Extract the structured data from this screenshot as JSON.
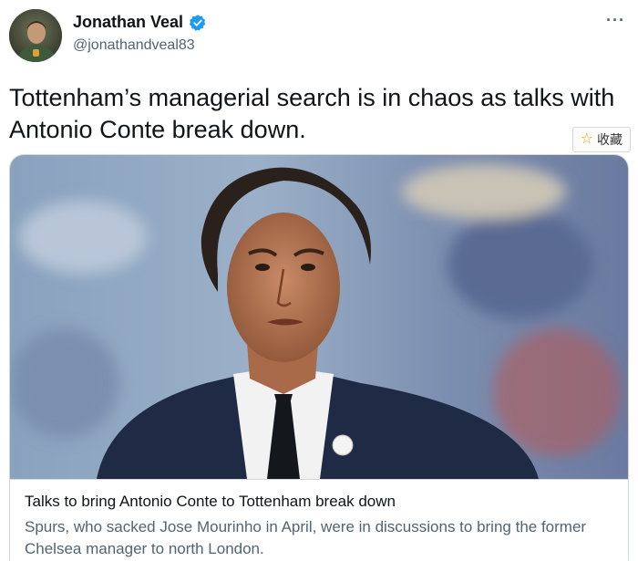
{
  "author": {
    "display_name": "Jonathan Veal",
    "handle": "@jonathandveal83",
    "verified": true,
    "avatar": "user-avatar"
  },
  "more_icon": "more-horizontal-icon",
  "more_label": "···",
  "tweet": {
    "text": "Tottenham’s managerial search is in chaos as talks with Antonio Conte break down."
  },
  "favorite": {
    "icon": "star-icon",
    "label": "收藏"
  },
  "card": {
    "image": "antonio-conte-photo",
    "title": "Talks to bring Antonio Conte to Tottenham break down",
    "description": "Spurs, who sacked Jose Mourinho in April, were in discussions to bring the former Chelsea manager to north London."
  },
  "colors": {
    "verified_badge": "#1d9bf0",
    "secondary_text": "#536471",
    "border": "#cfd9de",
    "star": "#e6a700"
  }
}
